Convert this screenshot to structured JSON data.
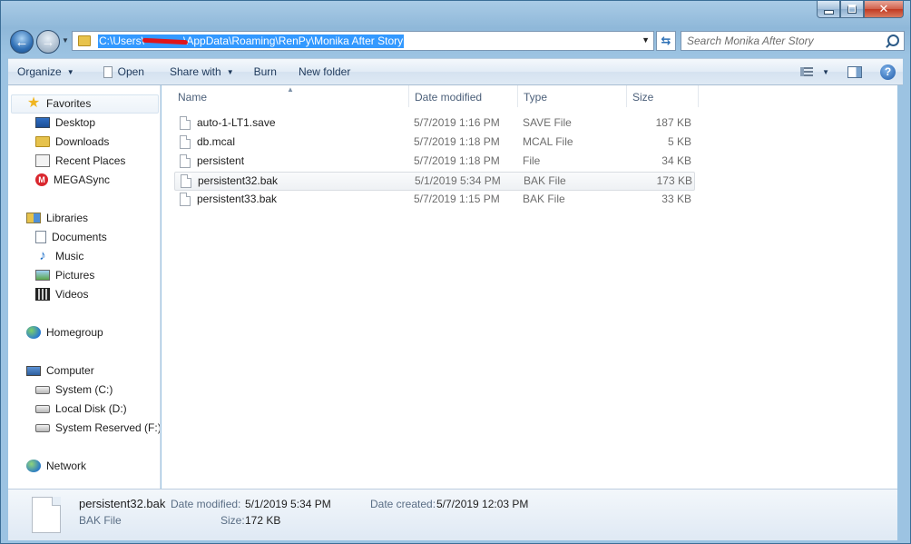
{
  "address": {
    "path_prefix": "C:\\Users\\",
    "path_suffix": "\\AppData\\Roaming\\RenPy\\Monika After Story"
  },
  "search": {
    "placeholder": "Search Monika After Story"
  },
  "toolbar": {
    "organize": "Organize",
    "open": "Open",
    "share_with": "Share with",
    "burn": "Burn",
    "new_folder": "New folder"
  },
  "sidebar": {
    "favorites": "Favorites",
    "favorites_items": [
      "Desktop",
      "Downloads",
      "Recent Places",
      "MEGASync"
    ],
    "libraries": "Libraries",
    "libraries_items": [
      "Documents",
      "Music",
      "Pictures",
      "Videos"
    ],
    "homegroup": "Homegroup",
    "computer": "Computer",
    "computer_items": [
      "System (C:)",
      "Local Disk (D:)",
      "System Reserved (F:)"
    ],
    "network": "Network"
  },
  "columns": {
    "name": "Name",
    "date_modified": "Date modified",
    "type": "Type",
    "size": "Size"
  },
  "files": [
    {
      "name": "auto-1-LT1.save",
      "date": "5/7/2019 1:16 PM",
      "type": "SAVE File",
      "size": "187 KB"
    },
    {
      "name": "db.mcal",
      "date": "5/7/2019 1:18 PM",
      "type": "MCAL File",
      "size": "5 KB"
    },
    {
      "name": "persistent",
      "date": "5/7/2019 1:18 PM",
      "type": "File",
      "size": "34 KB"
    },
    {
      "name": "persistent32.bak",
      "date": "5/1/2019 5:34 PM",
      "type": "BAK File",
      "size": "173 KB"
    },
    {
      "name": "persistent33.bak",
      "date": "5/7/2019 1:15 PM",
      "type": "BAK File",
      "size": "33 KB"
    }
  ],
  "details": {
    "filename": "persistent32.bak",
    "filetype": "BAK File",
    "date_modified_label": "Date modified:",
    "date_modified": "5/1/2019 5:34 PM",
    "size_label": "Size:",
    "size": "172 KB",
    "date_created_label": "Date created:",
    "date_created": "5/7/2019 12:03 PM"
  },
  "colors": {
    "selection": "#3399ff",
    "redaction": "#e0151b"
  }
}
